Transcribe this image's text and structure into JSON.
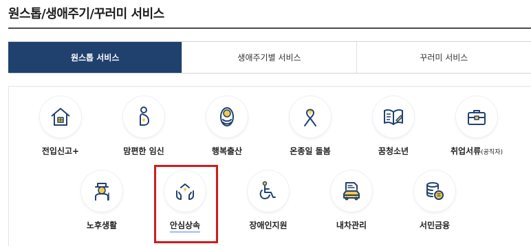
{
  "page": {
    "title": "원스톱/생애주기/꾸러미 서비스"
  },
  "tabs": [
    {
      "label": "원스톱 서비스",
      "active": true
    },
    {
      "label": "생애주기별 서비스",
      "active": false
    },
    {
      "label": "꾸러미 서비스",
      "active": false
    }
  ],
  "services": {
    "row1": [
      {
        "label": "전입신고+",
        "icon": "house-icon"
      },
      {
        "label": "맘편한 임신",
        "icon": "pregnancy-icon"
      },
      {
        "label": "행복출산",
        "icon": "baby-icon"
      },
      {
        "label": "온종일 돌봄",
        "icon": "ribbon-icon"
      },
      {
        "label": "꿈청소년",
        "icon": "book-icon"
      },
      {
        "label": "취업서류",
        "suffix": "(공직자)",
        "icon": "briefcase-icon"
      }
    ],
    "row2": [
      {
        "label": "노후생활",
        "icon": "elder-icon"
      },
      {
        "label": "안심상속",
        "icon": "hands-house-icon",
        "highlighted": true
      },
      {
        "label": "장애인지원",
        "icon": "wheelchair-icon"
      },
      {
        "label": "내차관리",
        "icon": "car-document-icon"
      },
      {
        "label": "서민금융",
        "icon": "coins-icon"
      }
    ]
  },
  "colors": {
    "active_tab": "#20406e",
    "icon_line": "#20406e",
    "icon_accent": "#f2c94c",
    "highlight_box": "#d11a1a"
  }
}
